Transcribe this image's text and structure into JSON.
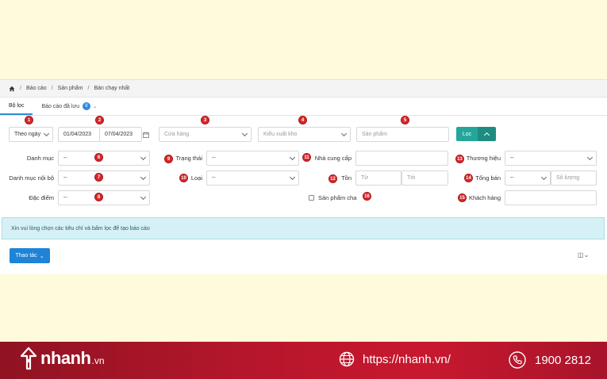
{
  "breadcrumb": {
    "items": [
      "Báo cáo",
      "Sản phẩm",
      "Bán chạy nhất"
    ],
    "sep": "/"
  },
  "tabs": [
    {
      "label": "Bộ lọc"
    },
    {
      "label": "Báo cáo đã lưu",
      "badge": "8"
    }
  ],
  "markers": [
    "1",
    "2",
    "3",
    "4",
    "5",
    "6",
    "7",
    "8",
    "9",
    "10",
    "11",
    "12",
    "13",
    "14",
    "15",
    "16"
  ],
  "filters": {
    "period": "Theo ngày",
    "date_from": "01/04/2023",
    "date_to": "07/04/2023",
    "store_placeholder": "Cửa hàng",
    "export_type_placeholder": "Kiểu xuất kho",
    "product_placeholder": "Sản phẩm",
    "filter_button": "Lọc",
    "category_label": "Danh mục",
    "category_value": "--",
    "internal_category_label": "Danh mục nội bộ",
    "internal_category_value": "--",
    "feature_label": "Đặc điểm",
    "feature_value": "--",
    "status_label": "Trạng thái",
    "status_value": "--",
    "type_label": "Loại",
    "type_value": "--",
    "supplier_label": "Nhà cung cấp",
    "stock_label": "Tồn",
    "stock_from_placeholder": "Từ",
    "stock_to_placeholder": "Tới",
    "parent_product_label": "Sản phẩm cha",
    "brand_label": "Thương hiệu",
    "brand_value": "--",
    "total_sold_label": "Tổng bán",
    "total_sold_op": "--",
    "quantity_placeholder": "Số lượng",
    "customer_label": "Khách hàng"
  },
  "alert": "Xin vui lòng chọn các tiêu chí và bấm lọc để tạo báo cáo",
  "actions": {
    "label": "Thao tác"
  },
  "banner": {
    "brand": "nhanh",
    "brand_suffix": ".vn",
    "website": "https://nhanh.vn/",
    "hotline": "1900 2812"
  },
  "colors": {
    "accent": "#26a69a",
    "primary": "#1f84d6",
    "marker": "#d9262a",
    "banner": "#b5162b"
  }
}
